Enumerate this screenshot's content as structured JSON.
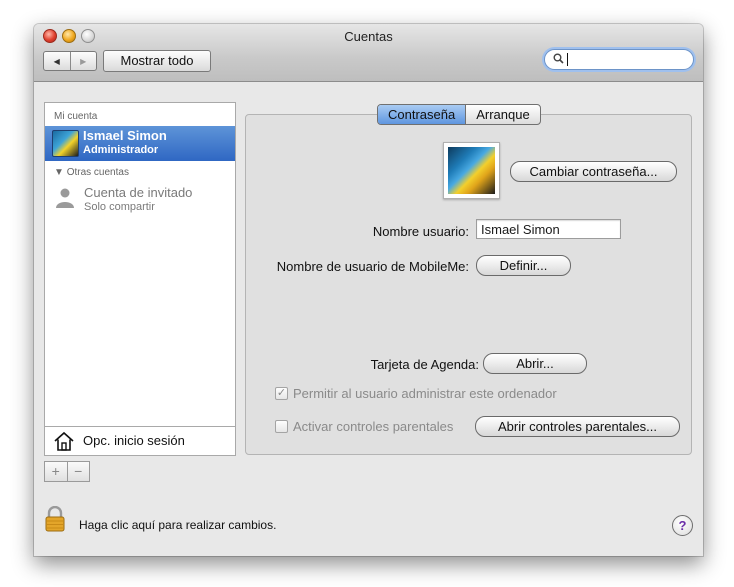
{
  "window": {
    "title": "Cuentas"
  },
  "toolbar": {
    "back_icon": "◀",
    "forward_icon": "▶",
    "show_all_label": "Mostrar todo",
    "search_value": "",
    "search_icon": "🔍"
  },
  "sidebar": {
    "my_account_header": "Mi cuenta",
    "current_user": {
      "name": "Ismael Simon",
      "role": "Administrador"
    },
    "other_accounts_header": "Otras cuentas",
    "guest": {
      "name": "Cuenta de invitado",
      "role": "Solo compartir"
    },
    "login_options_label": "Opc. inicio sesión",
    "add_label": "+",
    "remove_label": "−"
  },
  "tabs": [
    {
      "label": "Contraseña",
      "active": true
    },
    {
      "label": "Arranque",
      "active": false
    }
  ],
  "password_tab": {
    "change_password_label": "Cambiar contraseña...",
    "username_label": "Nombre usuario:",
    "username_value": "Ismael Simon",
    "mobileme_label": "Nombre de usuario de MobileMe:",
    "define_label": "Definir...",
    "address_card_label": "Tarjeta de Agenda:",
    "open_label": "Abrir...",
    "allow_admin_label": "Permitir al usuario administrar este ordenador",
    "allow_admin_checked": true,
    "parental_controls_label": "Activar controles parentales",
    "parental_controls_checked": false,
    "open_parental_label": "Abrir controles parentales..."
  },
  "footer": {
    "lock_text": "Haga clic aquí para realizar cambios.",
    "help_label": "?"
  },
  "colors": {
    "selection": "#2f67c3",
    "active_tab": "#5f96e0"
  }
}
